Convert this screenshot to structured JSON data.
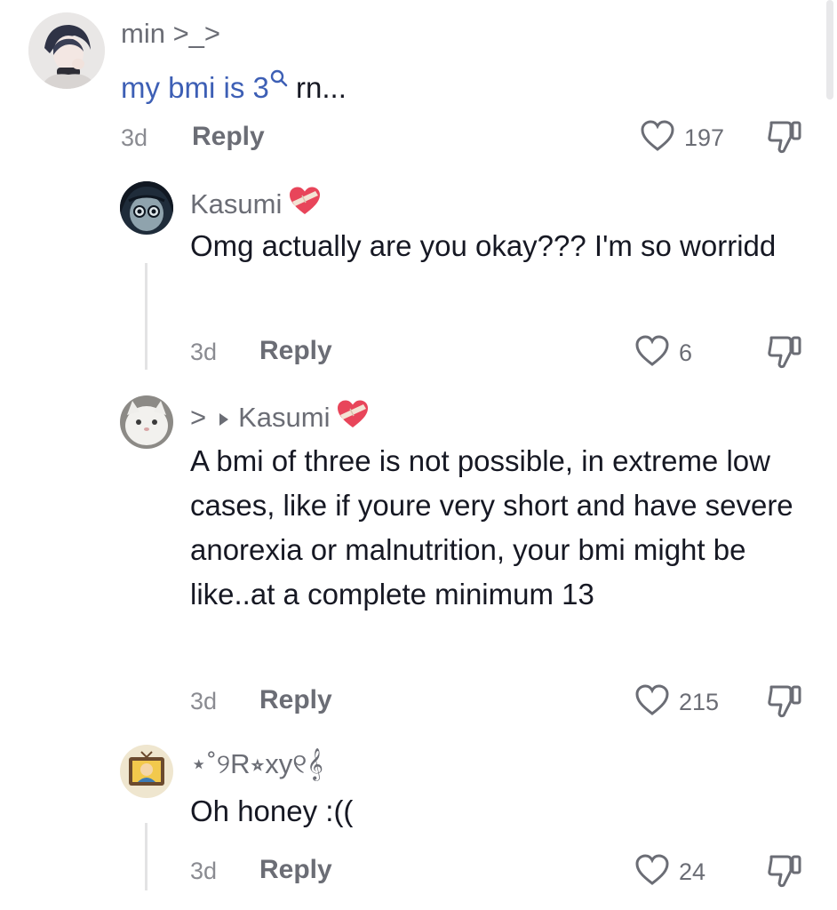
{
  "comments": [
    {
      "username": "min >_>",
      "text_link": "my bmi is 3",
      "text_rest": " rn...",
      "time": "3d",
      "reply_label": "Reply",
      "likes": "197"
    },
    {
      "username": "Kasumi",
      "text": "Omg actually are you okay??? I'm so worridd",
      "time": "3d",
      "reply_label": "Reply",
      "likes": "6"
    },
    {
      "username_prefix": ">",
      "reply_to": "Kasumi",
      "text": "A bmi of three is not possible, in extreme low cases, like if youre very short and have severe anorexia or malnutrition, your bmi might be like..at a complete minimum 13",
      "time": "3d",
      "reply_label": "Reply",
      "likes": "215"
    },
    {
      "username": "⋆˚୨R⭒xy୧𝄞",
      "text": "Oh honey :((",
      "time": "3d",
      "reply_label": "Reply",
      "likes": "24"
    }
  ],
  "icons": {
    "like": "heart-outline-icon",
    "dislike": "thumbs-down-icon",
    "search": "search-icon",
    "badge": "heart-bandage-icon"
  },
  "colors": {
    "link": "#3d5fb5",
    "badge_red": "#e8455a"
  }
}
